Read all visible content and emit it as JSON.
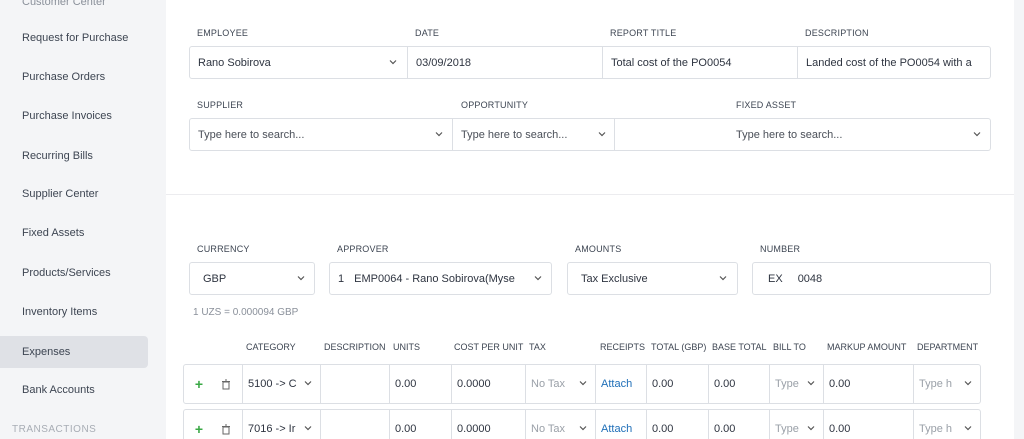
{
  "sidebar": {
    "items": [
      {
        "label": "Customer Center"
      },
      {
        "label": "Request for Purchase"
      },
      {
        "label": "Purchase Orders"
      },
      {
        "label": "Purchase Invoices"
      },
      {
        "label": "Recurring Bills"
      },
      {
        "label": "Supplier Center"
      },
      {
        "label": "Fixed Assets"
      },
      {
        "label": "Products/Services"
      },
      {
        "label": "Inventory Items"
      },
      {
        "label": "Expenses"
      },
      {
        "label": "Bank Accounts"
      }
    ],
    "section": "TRANSACTIONS",
    "active": "Expenses"
  },
  "form": {
    "employee": {
      "label": "EMPLOYEE",
      "value": "Rano Sobirova"
    },
    "date": {
      "label": "DATE",
      "value": "03/09/2018"
    },
    "report_title": {
      "label": "REPORT TITLE",
      "value": "Total cost of the PO0054"
    },
    "description": {
      "label": "DESCRIPTION",
      "value": "Landed cost of the PO0054 with a"
    },
    "supplier": {
      "label": "SUPPLIER",
      "placeholder": "Type here to search..."
    },
    "opportunity": {
      "label": "OPPORTUNITY",
      "placeholder": "Type here to search..."
    },
    "fixed_asset": {
      "label": "FIXED ASSET",
      "placeholder": "Type here to search..."
    },
    "currency": {
      "label": "CURRENCY",
      "value": "GBP"
    },
    "approver": {
      "label": "APPROVER",
      "index": "1",
      "value": "EMP0064 - Rano Sobirova(Myse"
    },
    "amounts": {
      "label": "AMOUNTS",
      "value": "Tax Exclusive"
    },
    "number": {
      "label": "NUMBER",
      "prefix": "EX",
      "value": "0048"
    },
    "exchange_note": "1 UZS = 0.000094 GBP"
  },
  "table": {
    "headers": [
      "CATEGORY",
      "DESCRIPTION",
      "UNITS",
      "COST PER UNIT",
      "TAX",
      "RECEIPTS",
      "TOTAL (GBP)",
      "BASE TOTAL",
      "BILL TO",
      "MARKUP AMOUNT",
      "DEPARTMENT"
    ],
    "rows": [
      {
        "category": "5100 -> C",
        "units": "0.00",
        "cost": "0.0000",
        "tax": "No Tax",
        "receipt": "Attach",
        "total": "0.00",
        "base_total": "0.00",
        "bill_to": "Type",
        "markup": "0.00",
        "department": "Type h"
      },
      {
        "category": "7016 -> Ir",
        "units": "0.00",
        "cost": "0.0000",
        "tax": "No Tax",
        "receipt": "Attach",
        "total": "0.00",
        "base_total": "0.00",
        "bill_to": "Type",
        "markup": "0.00",
        "department": "Type h"
      }
    ]
  },
  "colors": {
    "link": "#1f6fb8",
    "add": "#3aa845",
    "active_bg": "#dfe1e6"
  }
}
